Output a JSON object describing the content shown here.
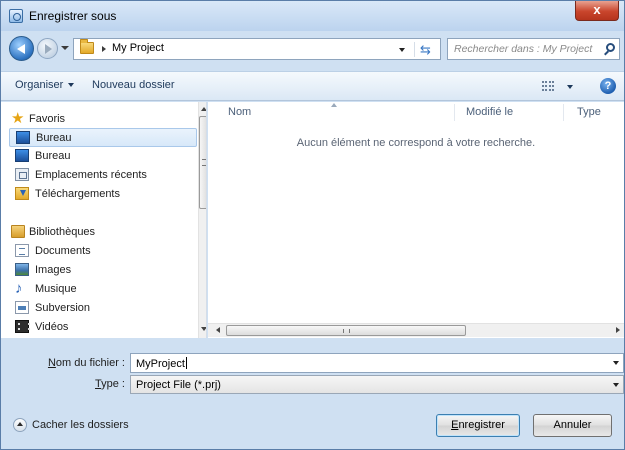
{
  "window": {
    "title": "Enregistrer sous",
    "close_label": "x"
  },
  "address": {
    "crumbs": [
      "My Project"
    ]
  },
  "search": {
    "placeholder": "Rechercher dans : My Project"
  },
  "toolbar": {
    "organize_label": "Organiser",
    "new_folder_label": "Nouveau dossier",
    "help_label": "?"
  },
  "navpane": {
    "favorites": {
      "label": "Favoris",
      "items": [
        {
          "label": "Bureau",
          "icon": "desktop-icon",
          "selected": true
        },
        {
          "label": "Bureau",
          "icon": "desktop-icon",
          "selected": false
        },
        {
          "label": "Emplacements récents",
          "icon": "recent-places-icon",
          "selected": false
        },
        {
          "label": "Téléchargements",
          "icon": "downloads-icon",
          "selected": false
        }
      ]
    },
    "libraries": {
      "label": "Bibliothèques",
      "items": [
        {
          "label": "Documents",
          "icon": "documents-icon"
        },
        {
          "label": "Images",
          "icon": "pictures-icon"
        },
        {
          "label": "Musique",
          "icon": "music-icon"
        },
        {
          "label": "Subversion",
          "icon": "subversion-icon"
        },
        {
          "label": "Vidéos",
          "icon": "videos-icon"
        }
      ]
    }
  },
  "content": {
    "columns": [
      "Nom",
      "Modifié le",
      "Type"
    ],
    "empty_message": "Aucun élément ne correspond à votre recherche."
  },
  "form": {
    "filename_label_mnemonic": "N",
    "filename_label_rest": "om du fichier :",
    "filename_value": "MyProject",
    "type_label_mnemonic": "T",
    "type_label_rest": "ype :",
    "type_value": "Project File (*.prj)"
  },
  "footer": {
    "hide_folders_label": "Cacher les dossiers",
    "save_mnemonic": "E",
    "save_rest": "nregistrer",
    "cancel_label": "Annuler"
  },
  "colors": {
    "accent": "#3c7fb1",
    "window_frame": "#cfe0f2",
    "close_button": "#c9452c"
  }
}
